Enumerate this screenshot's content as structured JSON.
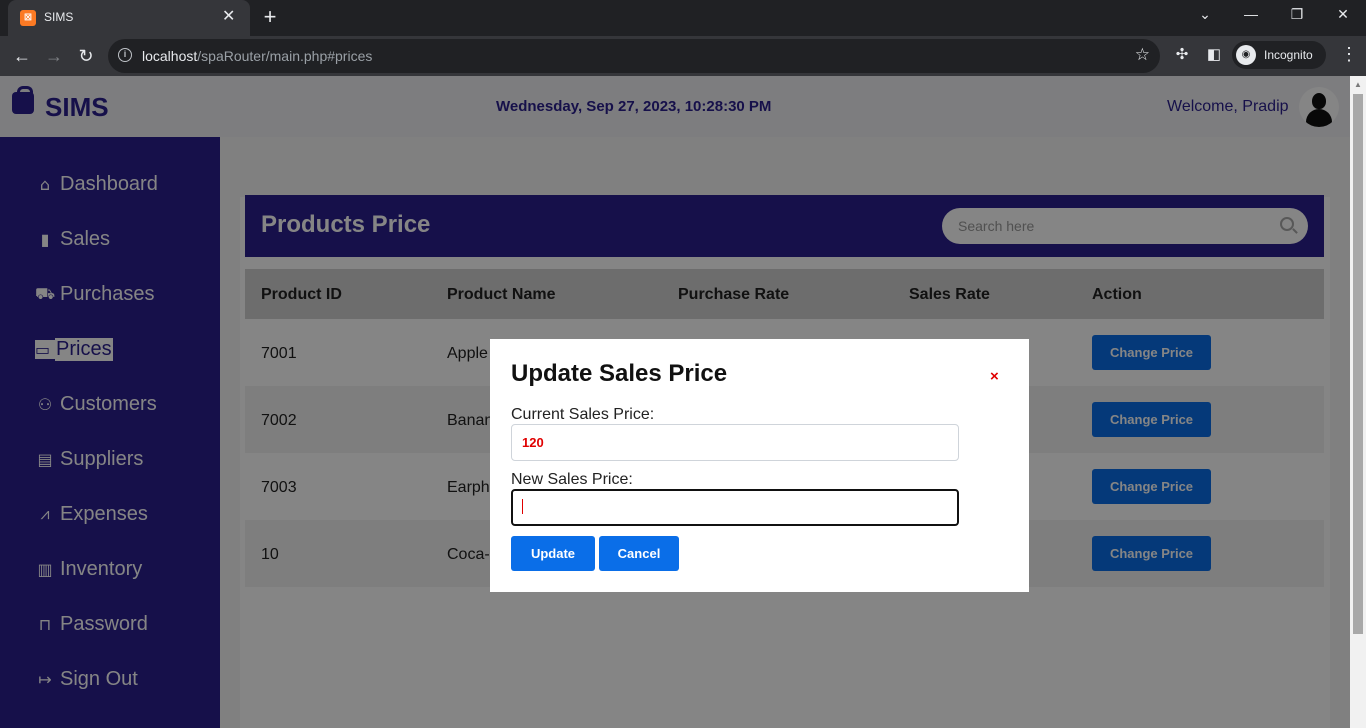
{
  "browser": {
    "tab_title": "SIMS",
    "tab_favicon": "⊠",
    "url_host": "localhost",
    "url_path": "/spaRouter/main.php#prices",
    "profile_label": "Incognito"
  },
  "header": {
    "logo_text": "SIMS",
    "datetime": "Wednesday, Sep 27, 2023, 10:28:30 PM",
    "welcome": "Welcome, Pradip"
  },
  "sidebar": {
    "items": [
      {
        "label": "Dashboard",
        "icon": "home-icon",
        "glyph": "⌂"
      },
      {
        "label": "Sales",
        "icon": "bar-chart-icon",
        "glyph": "▮"
      },
      {
        "label": "Purchases",
        "icon": "cart-icon",
        "glyph": "⛟"
      },
      {
        "label": "Prices",
        "icon": "credit-card-icon",
        "glyph": "▭"
      },
      {
        "label": "Customers",
        "icon": "people-icon",
        "glyph": "⚇"
      },
      {
        "label": "Suppliers",
        "icon": "briefcase-icon",
        "glyph": "▤"
      },
      {
        "label": "Expenses",
        "icon": "graph-up-icon",
        "glyph": "⩘"
      },
      {
        "label": "Inventory",
        "icon": "inventory-chart-icon",
        "glyph": "▥"
      },
      {
        "label": "Password",
        "icon": "lock-icon",
        "glyph": "⊓"
      },
      {
        "label": "Sign Out",
        "icon": "sign-out-icon",
        "glyph": "↦"
      }
    ],
    "active": "Prices"
  },
  "page": {
    "title": "Products Price",
    "search_placeholder": "Search here"
  },
  "table": {
    "columns": [
      "Product ID",
      "Product Name",
      "Purchase Rate",
      "Sales Rate",
      "Action"
    ],
    "rows": [
      {
        "id": "7001",
        "name": "Apple",
        "action": "Change Price"
      },
      {
        "id": "7002",
        "name": "Banan",
        "action": "Change Price"
      },
      {
        "id": "7003",
        "name": "Earph",
        "action": "Change Price"
      },
      {
        "id": "10",
        "name": "Coca-C",
        "action": "Change Price"
      }
    ]
  },
  "modal": {
    "title": "Update Sales Price",
    "close": "×",
    "current_label": "Current Sales Price:",
    "current_value": "120",
    "new_label": "New Sales Price:",
    "new_value": "",
    "update_label": "Update",
    "cancel_label": "Cancel"
  },
  "colors": {
    "brand": "#2b1f8f",
    "button": "#0a6ee8",
    "danger": "#e00000"
  }
}
